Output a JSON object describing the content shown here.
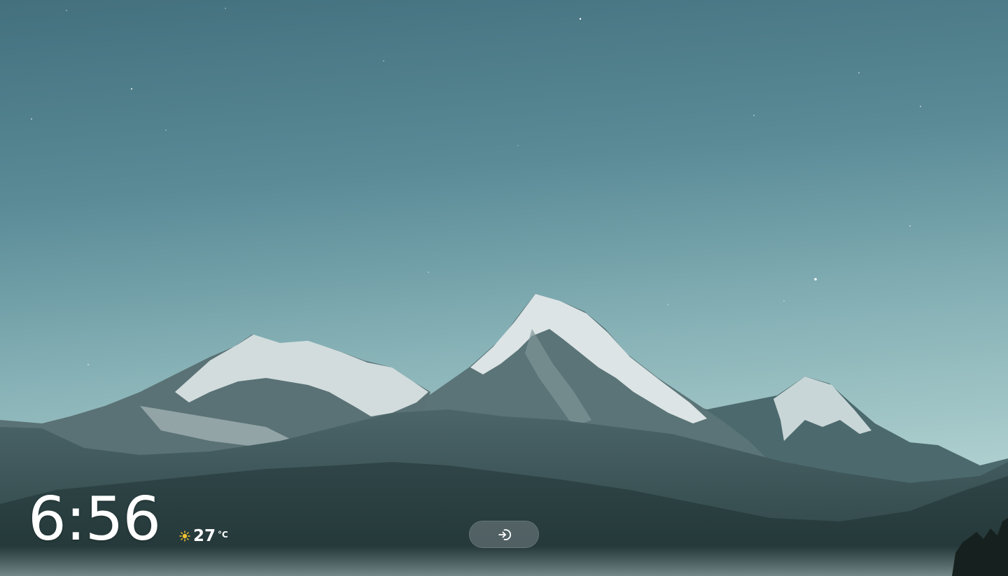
{
  "lock_screen": {
    "time": "6:56",
    "weather": {
      "icon": "sun-icon",
      "temperature": "27",
      "unit": "°C"
    },
    "login_button": {
      "icon": "login-arrow-icon"
    }
  },
  "colors": {
    "sky_top": "#4f7b87",
    "sky_bottom": "#a9ccce",
    "mountain_dark": "#2b3f41",
    "snow": "#e8eff0",
    "sun": "#f2c230",
    "button_bg": "rgba(160,170,175,0.35)"
  }
}
